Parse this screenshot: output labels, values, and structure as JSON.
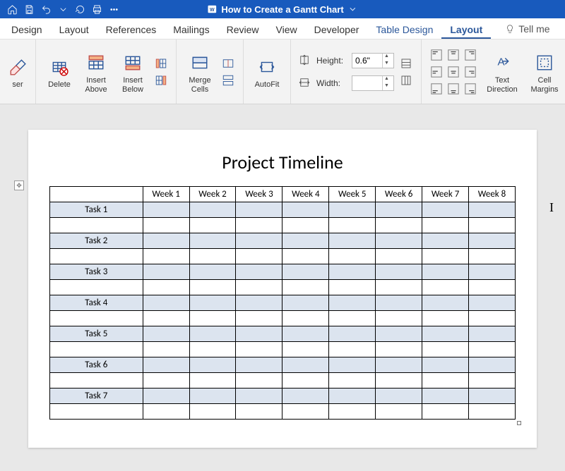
{
  "titlebar": {
    "document_name": "How to Create a Gantt Chart"
  },
  "tabs": {
    "design": "Design",
    "layout_page": "Layout",
    "references": "References",
    "mailings": "Mailings",
    "review": "Review",
    "view": "View",
    "developer": "Developer",
    "table_design": "Table Design",
    "layout_table": "Layout",
    "tellme": "Tell me"
  },
  "ribbon": {
    "eraser": "ser",
    "delete": "Delete",
    "insert_above": "Insert\nAbove",
    "insert_below": "Insert\nBelow",
    "merge_cells": "Merge\nCells",
    "autofit": "AutoFit",
    "height_label": "Height:",
    "height_value": "0.6\"",
    "width_label": "Width:",
    "width_value": "",
    "text_direction": "Text\nDirection",
    "cell_margins": "Cell\nMargins"
  },
  "document": {
    "heading": "Project Timeline",
    "columns": [
      "",
      "Week 1",
      "Week 2",
      "Week 3",
      "Week 4",
      "Week 5",
      "Week 6",
      "Week 7",
      "Week 8"
    ],
    "rows": [
      "Task 1",
      "Task 2",
      "Task 3",
      "Task 4",
      "Task 5",
      "Task 6",
      "Task 7"
    ]
  },
  "chart_data": {
    "type": "table",
    "title": "Project Timeline",
    "columns": [
      "Week 1",
      "Week 2",
      "Week 3",
      "Week 4",
      "Week 5",
      "Week 6",
      "Week 7",
      "Week 8"
    ],
    "rows": [
      "Task 1",
      "Task 2",
      "Task 3",
      "Task 4",
      "Task 5",
      "Task 6",
      "Task 7"
    ],
    "note": "Empty Gantt grid — tasks along rows, weeks along columns; no cells populated yet."
  }
}
